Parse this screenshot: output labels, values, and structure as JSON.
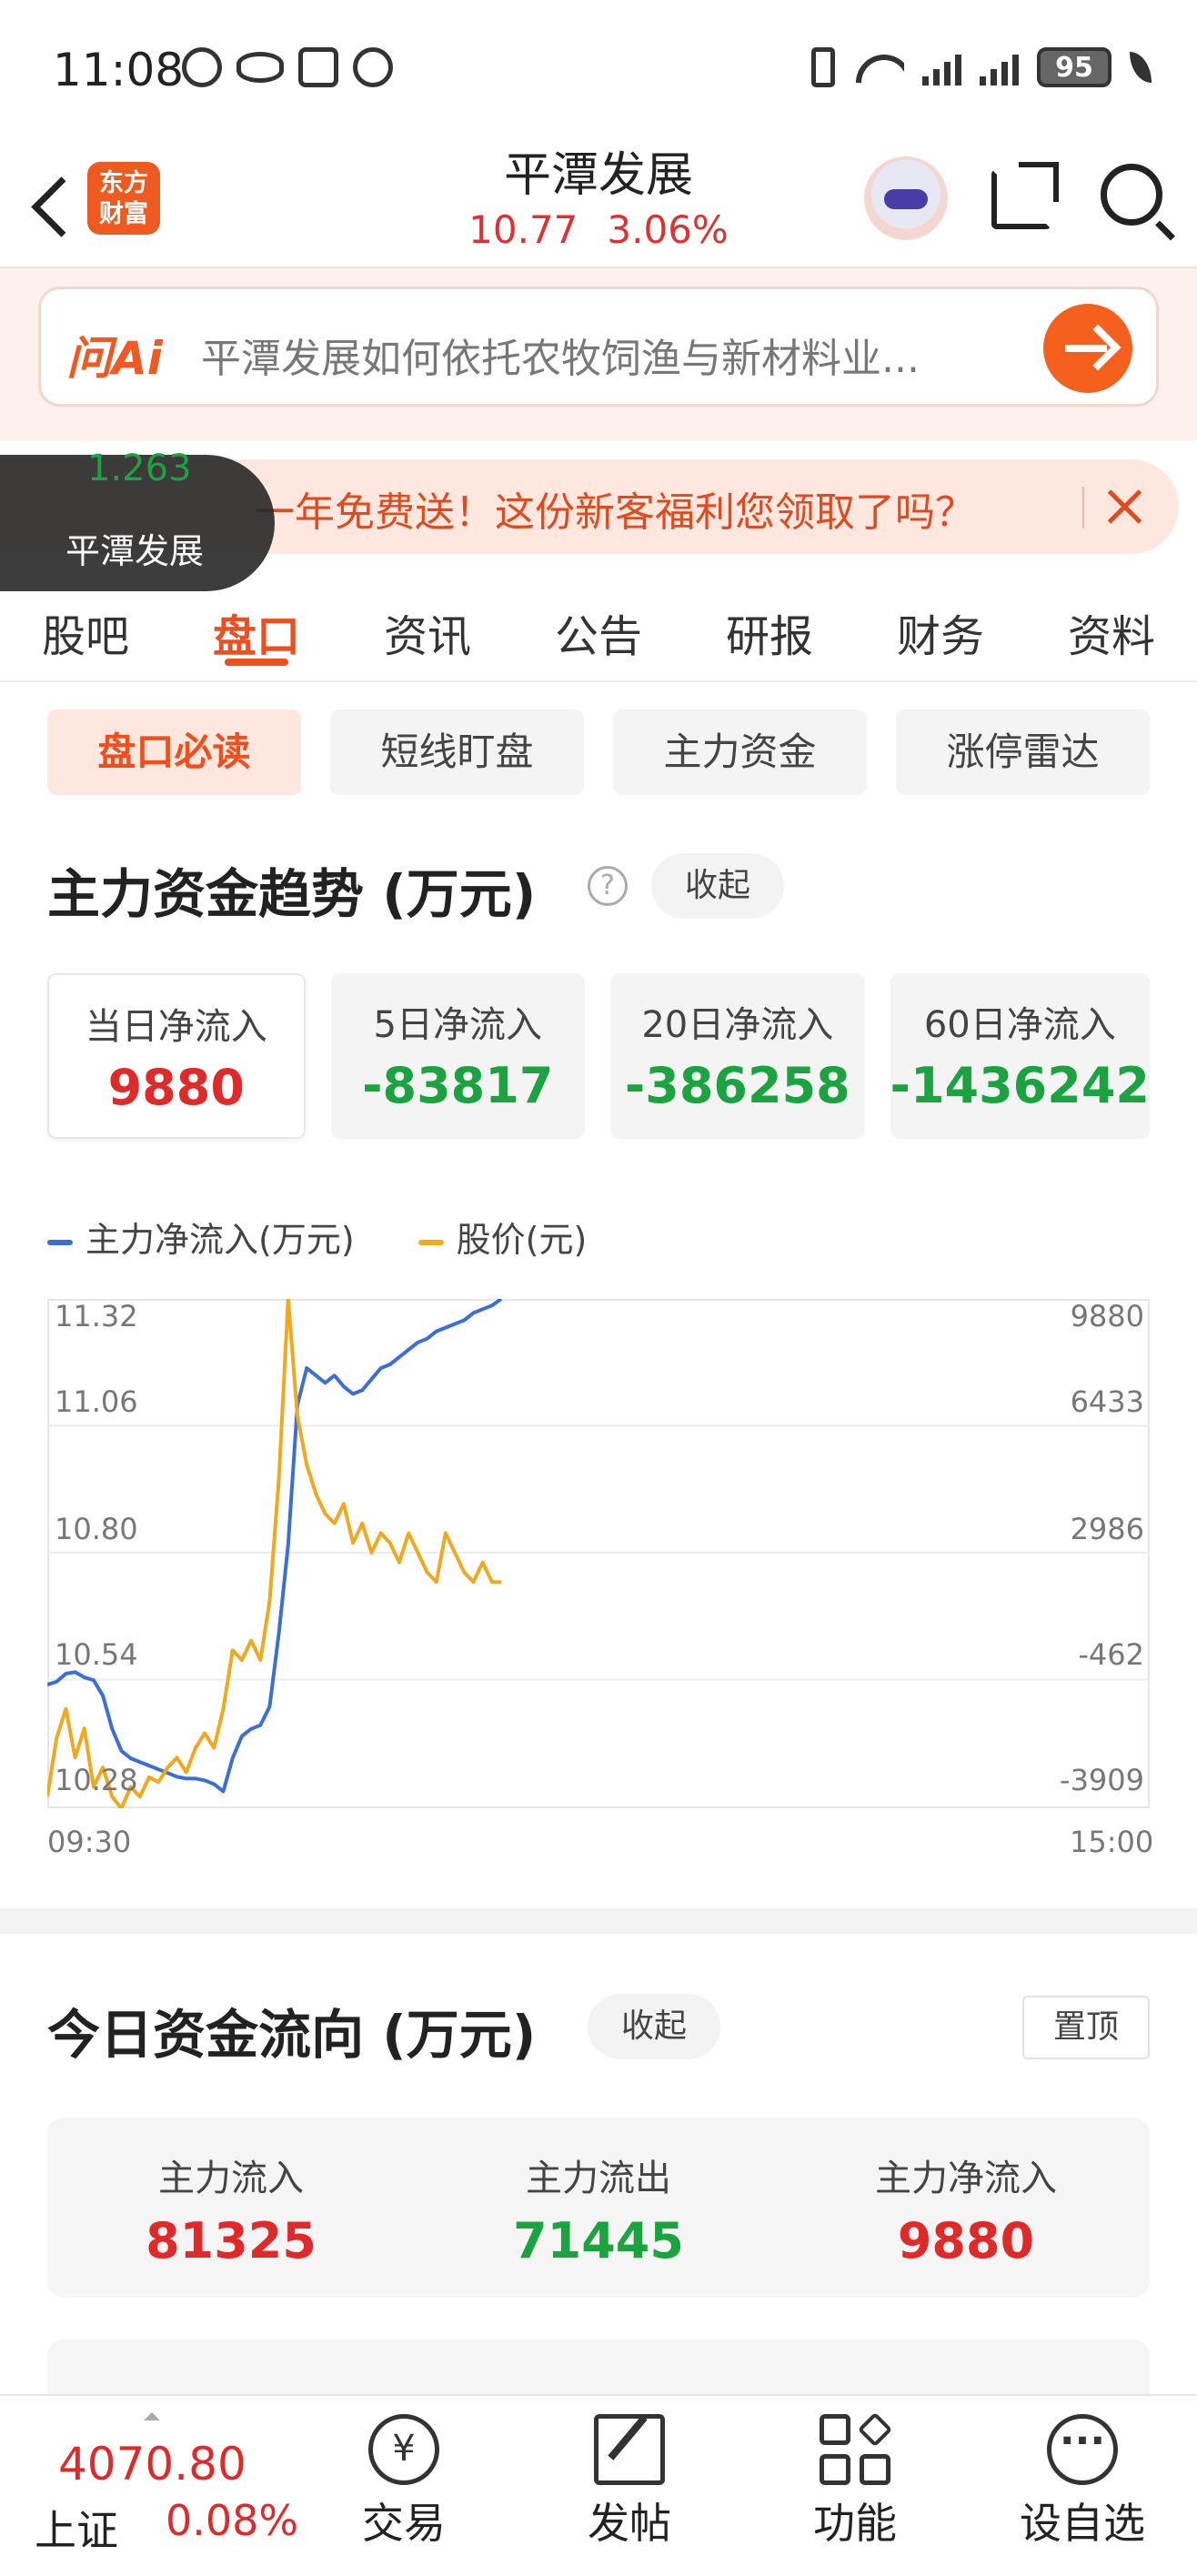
{
  "status_bar": {
    "time": "11:08",
    "battery": "95",
    "icons": [
      "moon-sync-icon",
      "eye-icon",
      "nfc-icon",
      "alarm-icon",
      "vibrate-icon",
      "wifi-icon",
      "signal-icon",
      "signal-icon",
      "battery-icon",
      "leaf-icon"
    ]
  },
  "header": {
    "logo_text": "东方财富",
    "title": "平潭发展",
    "price": "10.77",
    "change_pct": "3.06%"
  },
  "ai_bar": {
    "logo": "问Ai",
    "placeholder": "平潭发展如何依托农牧饲渔与新材料业..."
  },
  "promo": {
    "text": "一年免费送！这份新客福利您领取了吗？"
  },
  "float_tag": {
    "ghost_value": "1.263",
    "label": "平潭发展"
  },
  "tabs": [
    {
      "label": "股吧",
      "active": false
    },
    {
      "label": "盘口",
      "active": true
    },
    {
      "label": "资讯",
      "active": false
    },
    {
      "label": "公告",
      "active": false
    },
    {
      "label": "研报",
      "active": false
    },
    {
      "label": "财务",
      "active": false
    },
    {
      "label": "资料",
      "active": false
    }
  ],
  "subtabs": [
    {
      "label": "盘口必读",
      "active": true
    },
    {
      "label": "短线盯盘",
      "active": false
    },
    {
      "label": "主力资金",
      "active": false
    },
    {
      "label": "涨停雷达",
      "active": false
    }
  ],
  "trend_section": {
    "title": "主力资金趋势 (万元)",
    "help": "?",
    "collapse_label": "收起",
    "cards": [
      {
        "label": "当日净流入",
        "value": "9880",
        "color": "red",
        "active": true
      },
      {
        "label": "5日净流入",
        "value": "-83817",
        "color": "green",
        "active": false
      },
      {
        "label": "20日净流入",
        "value": "-386258",
        "color": "green",
        "active": false
      },
      {
        "label": "60日净流入",
        "value": "-1436242",
        "color": "green",
        "active": false
      }
    ],
    "legend": [
      {
        "name": "主力净流入(万元)",
        "color": "#3b6fd6"
      },
      {
        "name": "股价(元)",
        "color": "#f0a81e"
      }
    ]
  },
  "chart_data": {
    "type": "line",
    "x_start_label": "09:30",
    "x_end_label": "15:00",
    "left_axis_ticks": [
      "11.32",
      "11.06",
      "10.80",
      "10.54",
      "10.28"
    ],
    "right_axis_ticks": [
      "9880",
      "6433",
      "2986",
      "-462",
      "-3909"
    ],
    "left_range": [
      10.28,
      11.32
    ],
    "right_range": [
      -3909,
      9880
    ],
    "series": [
      {
        "name": "主力净流入(万元)",
        "axis": "right",
        "color": "#3b6fd6",
        "values": [
          -600,
          -520,
          -300,
          -260,
          -400,
          -480,
          -900,
          -1800,
          -2400,
          -2600,
          -2700,
          -2800,
          -2900,
          -3000,
          -3100,
          -3150,
          -3150,
          -3200,
          -3300,
          -3500,
          -2600,
          -2000,
          -1800,
          -1700,
          -1200,
          800,
          3200,
          7000,
          8000,
          7800,
          7600,
          7800,
          7500,
          7300,
          7400,
          7700,
          8000,
          8100,
          8300,
          8500,
          8700,
          8800,
          9000,
          9100,
          9200,
          9300,
          9500,
          9600,
          9700,
          9880
        ]
      },
      {
        "name": "股价(元)",
        "axis": "left",
        "color": "#f0a81e",
        "values": [
          10.3,
          10.42,
          10.48,
          10.38,
          10.44,
          10.32,
          10.36,
          10.3,
          10.27,
          10.32,
          10.3,
          10.34,
          10.33,
          10.36,
          10.38,
          10.35,
          10.4,
          10.43,
          10.4,
          10.48,
          10.6,
          10.58,
          10.62,
          10.58,
          10.7,
          10.95,
          11.32,
          11.08,
          10.98,
          10.92,
          10.88,
          10.86,
          10.9,
          10.82,
          10.86,
          10.8,
          10.84,
          10.82,
          10.78,
          10.84,
          10.8,
          10.76,
          10.74,
          10.84,
          10.8,
          10.76,
          10.74,
          10.78,
          10.74,
          10.74
        ]
      }
    ]
  },
  "today_section": {
    "title": "今日资金流向 (万元)",
    "collapse_label": "收起",
    "pin_label": "置顶",
    "items": [
      {
        "label": "主力流入",
        "value": "81325",
        "color": "red"
      },
      {
        "label": "主力流出",
        "value": "71445",
        "color": "green"
      },
      {
        "label": "主力净流入",
        "value": "9880",
        "color": "red"
      }
    ]
  },
  "bottom_bar": {
    "index_value": "4070.80",
    "index_name": "上证",
    "index_change": "0.08%",
    "nav": [
      {
        "label": "交易",
        "icon": "yen-icon"
      },
      {
        "label": "发帖",
        "icon": "edit-icon"
      },
      {
        "label": "功能",
        "icon": "grid-icon"
      },
      {
        "label": "设自选",
        "icon": "add-watch-icon"
      }
    ]
  }
}
